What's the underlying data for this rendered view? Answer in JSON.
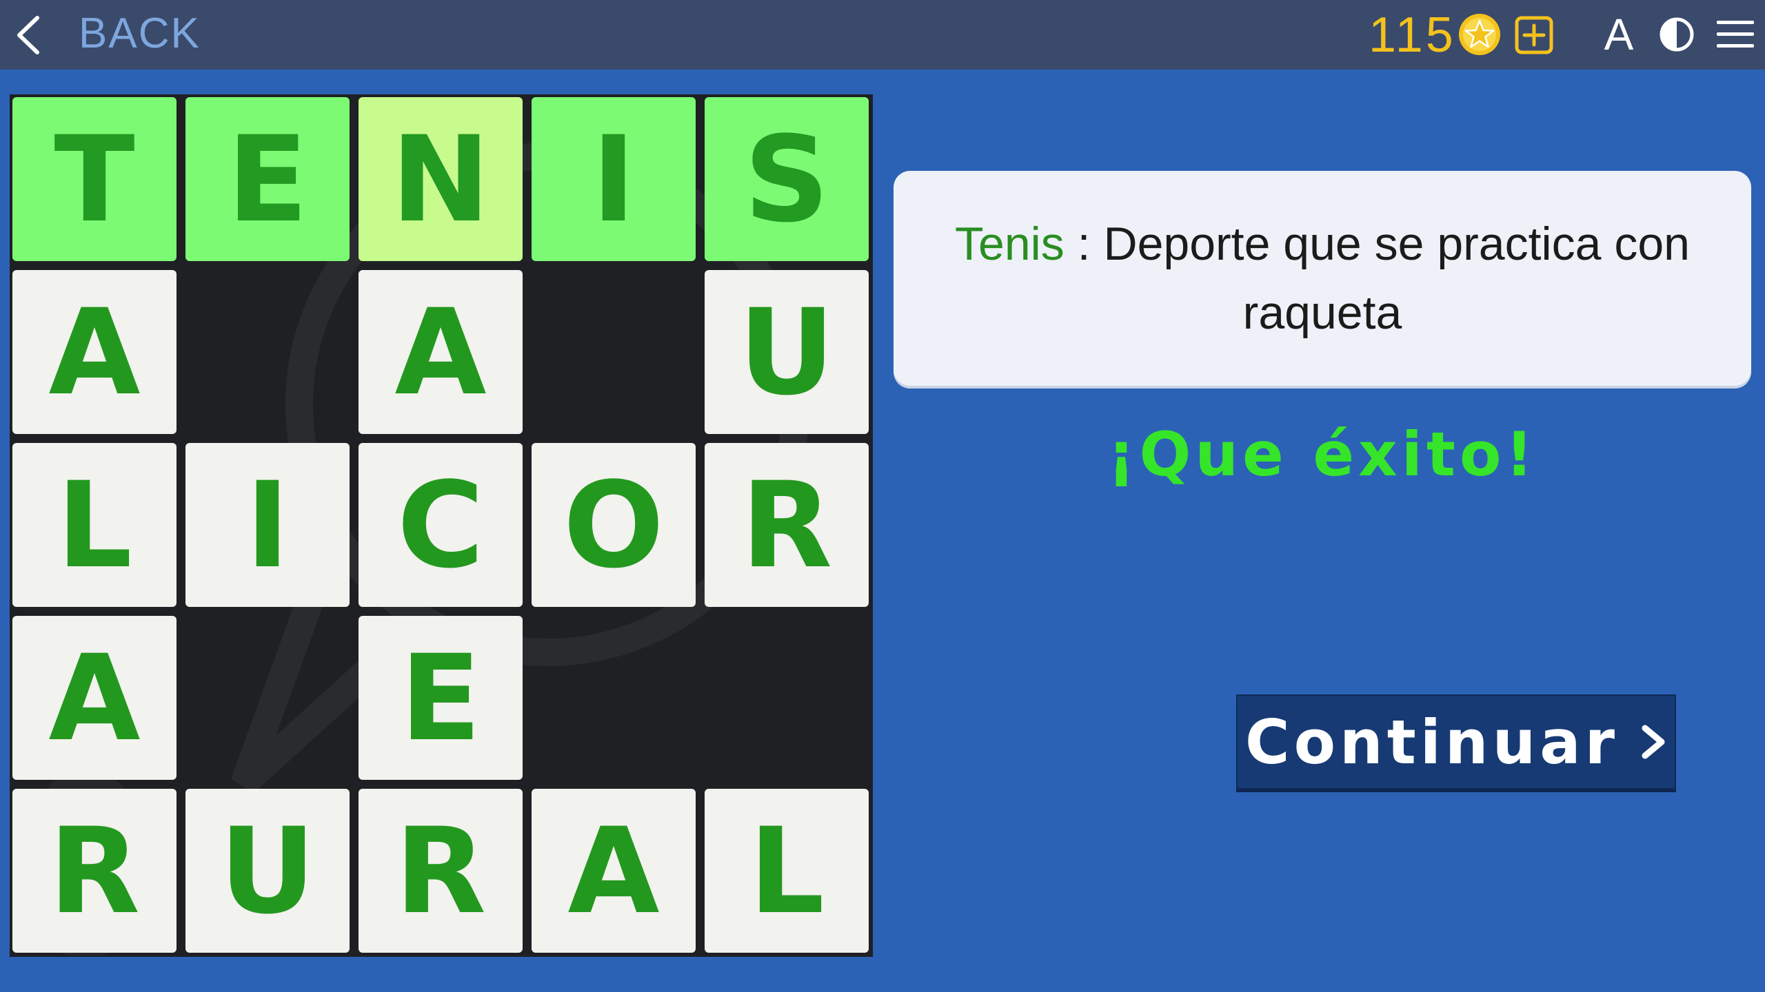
{
  "topbar": {
    "back_label": "BACK",
    "coins": "115",
    "font_button_label": "A",
    "icons": [
      "chevron-left-icon",
      "star-coin-icon",
      "plus-box-icon",
      "contrast-icon",
      "hamburger-menu-icon"
    ]
  },
  "board": {
    "size": 5,
    "rows": [
      [
        "T",
        "E",
        "N",
        "I",
        "S"
      ],
      [
        "A",
        "",
        "A",
        "",
        "U"
      ],
      [
        "L",
        "I",
        "C",
        "O",
        "R"
      ],
      [
        "A",
        "",
        "E",
        "",
        ""
      ],
      [
        "R",
        "U",
        "R",
        "A",
        "L"
      ]
    ],
    "solved_word_row": 0,
    "active_cell": [
      0,
      2
    ]
  },
  "clue": {
    "word": "Tenis",
    "separator": " : ",
    "definition": "Deporte que se practica con raqueta"
  },
  "success_message": "¡Que éxito!",
  "continue_label": "Continuar",
  "colors": {
    "background": "#2b62b5",
    "topbar": "#3a4a6b",
    "cell": "#f2f2ee",
    "solved_cell": "#7cfa74",
    "active_cell": "#c8fb8e",
    "letter": "#23981f",
    "coins": "#f4c21c",
    "success": "#36e52a",
    "continue_button": "#173a74"
  }
}
